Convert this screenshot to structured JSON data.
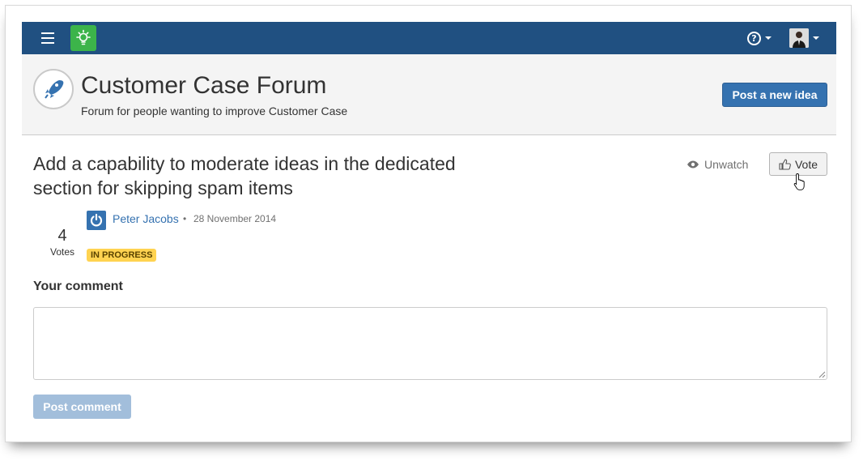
{
  "nav": {
    "menu_icon": "hamburger-icon",
    "app_icon": "lightbulb-icon",
    "help_icon": "help-icon",
    "help_glyph": "?",
    "user_icon": "user-avatar"
  },
  "header": {
    "title": "Customer Case Forum",
    "subtitle": "Forum for people wanting to improve Customer Case",
    "logo_icon": "rocket-icon",
    "post_idea_label": "Post a new idea"
  },
  "idea": {
    "title": "Add a capability to moderate ideas in the dedicated section for skipping spam items",
    "unwatch_label": "Unwatch",
    "vote_label": "Vote",
    "votes_count": "4",
    "votes_label": "Votes",
    "author": "Peter Jacobs",
    "separator": "•",
    "date": "28 November 2014",
    "status": "IN PROGRESS"
  },
  "comment": {
    "label": "Your comment",
    "placeholder": "",
    "submit_label": "Post comment"
  },
  "colors": {
    "nav_bg": "#205081",
    "primary": "#3572b0",
    "app_logo": "#3cb44a",
    "status_badge": "#ffd351",
    "disabled_button": "#a2bedb"
  }
}
